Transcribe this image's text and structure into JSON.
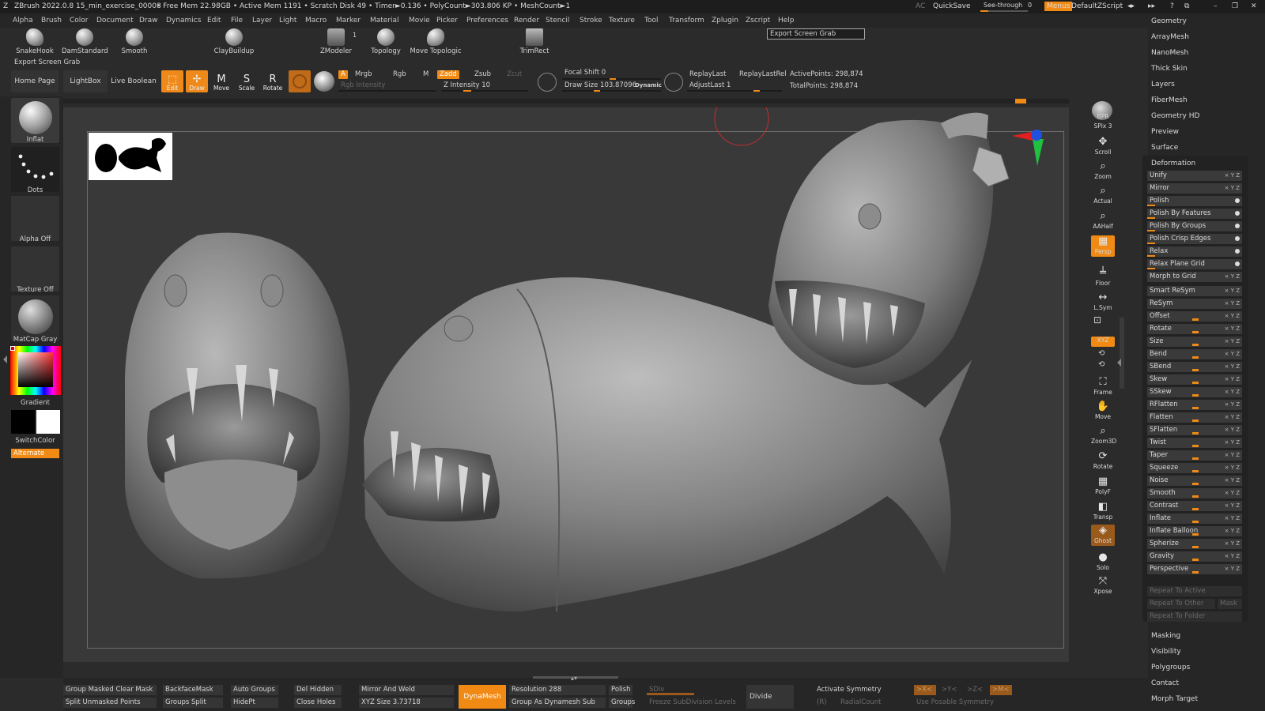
{
  "title_bar": {
    "app": "ZBrush 2022.0.8",
    "file": "15_min_exercise_00008",
    "stats": "• Free Mem 22.98GB • Active Mem 1191 • Scratch Disk 49 • Timer►0.136 • PolyCount►303.806 KP • MeshCount►1",
    "ac": "AC",
    "quicksave": "QuickSave",
    "seethrough": "See-through",
    "seethrough_value": "0",
    "menus": "Menus",
    "script": "DefaultZScript"
  },
  "menu": [
    "Alpha",
    "Brush",
    "Color",
    "Document",
    "Draw",
    "Dynamics",
    "Edit",
    "File",
    "Layer",
    "Light",
    "Macro",
    "Marker",
    "Material",
    "Movie",
    "Picker",
    "Preferences",
    "Render",
    "Stencil",
    "Stroke",
    "Texture",
    "Tool",
    "Transform",
    "Zplugin",
    "Zscript",
    "Help"
  ],
  "shelf": {
    "brushes": [
      "SnakeHook",
      "DamStandard",
      "Smooth",
      "ClayBuildup",
      "ZModeler",
      "Topology",
      "Move Topologic",
      "TrimRect"
    ],
    "zmodeler_count": "1",
    "tooltip": "Export Screen Grab",
    "export_label": "Export Screen Grab"
  },
  "toolbar": {
    "home_page": "Home Page",
    "lightbox": "LightBox",
    "live_boolean": "Live Boolean",
    "modes": [
      "Edit",
      "Draw",
      "Move",
      "Scale",
      "Rotate"
    ],
    "a_label": "A",
    "mrgb": "Mrgb",
    "rgb": "Rgb",
    "m": "M",
    "zadd": "Zadd",
    "zsub": "Zsub",
    "zcut": "Zcut",
    "rgb_intensity": "Rgb Intensity",
    "z_intensity": "Z Intensity 10",
    "focal_shift": "Focal Shift 0",
    "draw_size": "Draw Size 103.87096",
    "dynamic": "Dynamic",
    "replay_last": "ReplayLast",
    "replay_last_rel": "ReplayLastRel",
    "adjust_last": "AdjustLast 1",
    "active_points": "ActivePoints: 298,874",
    "total_points": "TotalPoints: 298,874"
  },
  "left_tray": {
    "inflat": "Inflat",
    "dots": "Dots",
    "alpha_off": "Alpha Off",
    "texture_off": "Texture Off",
    "matcap": "MatCap Gray",
    "gradient": "Gradient",
    "switch_color": "SwitchColor",
    "alternate": "Alternate"
  },
  "right_shelf": [
    {
      "label": "BPR",
      "icon": "bpr-icon"
    },
    {
      "label": "SPix 3",
      "icon": "spix-icon"
    },
    {
      "label": "Scroll",
      "icon": "scroll-icon"
    },
    {
      "label": "Zoom",
      "icon": "zoom-icon"
    },
    {
      "label": "Actual",
      "icon": "actual-icon"
    },
    {
      "label": "AAHalf",
      "icon": "aahalf-icon"
    },
    {
      "label": "Persp",
      "icon": "persp-icon"
    },
    {
      "label": "Floor",
      "icon": "floor-icon"
    },
    {
      "label": "L.Sym",
      "icon": "lsym-icon"
    },
    {
      "label": "XYZ",
      "icon": "xyz-icon"
    },
    {
      "label": "Frame",
      "icon": "frame-icon"
    },
    {
      "label": "Move",
      "icon": "move-icon"
    },
    {
      "label": "Zoom3D",
      "icon": "zoom3d-icon"
    },
    {
      "label": "Rotate",
      "icon": "rotate-icon"
    },
    {
      "label": "PolyF",
      "icon": "polyf-icon"
    },
    {
      "label": "Transp",
      "icon": "transp-icon"
    },
    {
      "label": "Ghost",
      "icon": "ghost-icon"
    },
    {
      "label": "Solo",
      "icon": "solo-icon"
    },
    {
      "label": "Xpose",
      "icon": "xpose-icon"
    }
  ],
  "right_panel": {
    "top_items": [
      "Geometry",
      "ArrayMesh",
      "NanoMesh",
      "Thick Skin",
      "Layers",
      "FiberMesh",
      "Geometry HD",
      "Preview",
      "Surface"
    ],
    "deformation_title": "Deformation",
    "deformation_items": [
      "Unify",
      "Mirror",
      "Polish",
      "Polish By Features",
      "Polish By Groups",
      "Polish Crisp Edges",
      "Relax",
      "Relax Plane Grid",
      "Morph to Grid",
      "Smart ReSym",
      "ReSym",
      "Offset",
      "Rotate",
      "Size",
      "Bend",
      "SBend",
      "Skew",
      "SSkew",
      "RFlatten",
      "Flatten",
      "SFlatten",
      "Twist",
      "Taper",
      "Squeeze",
      "Noise",
      "Smooth",
      "Contrast",
      "Inflate",
      "Inflate Balloon",
      "Spherize",
      "Gravity",
      "Perspective"
    ],
    "repeat_items": [
      "Repeat To Active",
      "Repeat To Other",
      "Repeat To Folder"
    ],
    "mask": "Mask",
    "bottom_items": [
      "Masking",
      "Visibility",
      "Polygroups",
      "Contact",
      "Morph Target"
    ]
  },
  "bottom_tray": {
    "group_masked_clear_mask": "Group Masked Clear Mask",
    "split_unmasked_points": "Split Unmasked Points",
    "backface_mask": "BackfaceMask",
    "groups_split": "Groups Split",
    "auto_groups": "Auto Groups",
    "hide_pt": "HidePt",
    "del_hidden": "Del Hidden",
    "close_holes": "Close Holes",
    "mirror_and_weld": "Mirror And Weld",
    "xyz_size": "XYZ Size 3.73718",
    "dynamesh": "DynaMesh",
    "resolution": "Resolution 288",
    "group_as_dynamesh_sub": "Group As Dynamesh Sub",
    "polish": "Polish",
    "groups": "Groups",
    "sdiv": "SDiv",
    "freeze_subdivision_levels": "Freeze SubDivision Levels",
    "divide": "Divide",
    "activate_symmetry": "Activate Symmetry",
    "r": "(R)",
    "radial_count": "RadialCount",
    "use_posable_symmetry": "Use Posable Symmetry",
    "x_axis": ">X<",
    "y_axis": ">Y<",
    "z_axis": ">Z<",
    "m_axis": ">M<"
  },
  "colors": {
    "accent": "#f08a14",
    "background": "#2b2b2b",
    "canvas": "#393939"
  }
}
